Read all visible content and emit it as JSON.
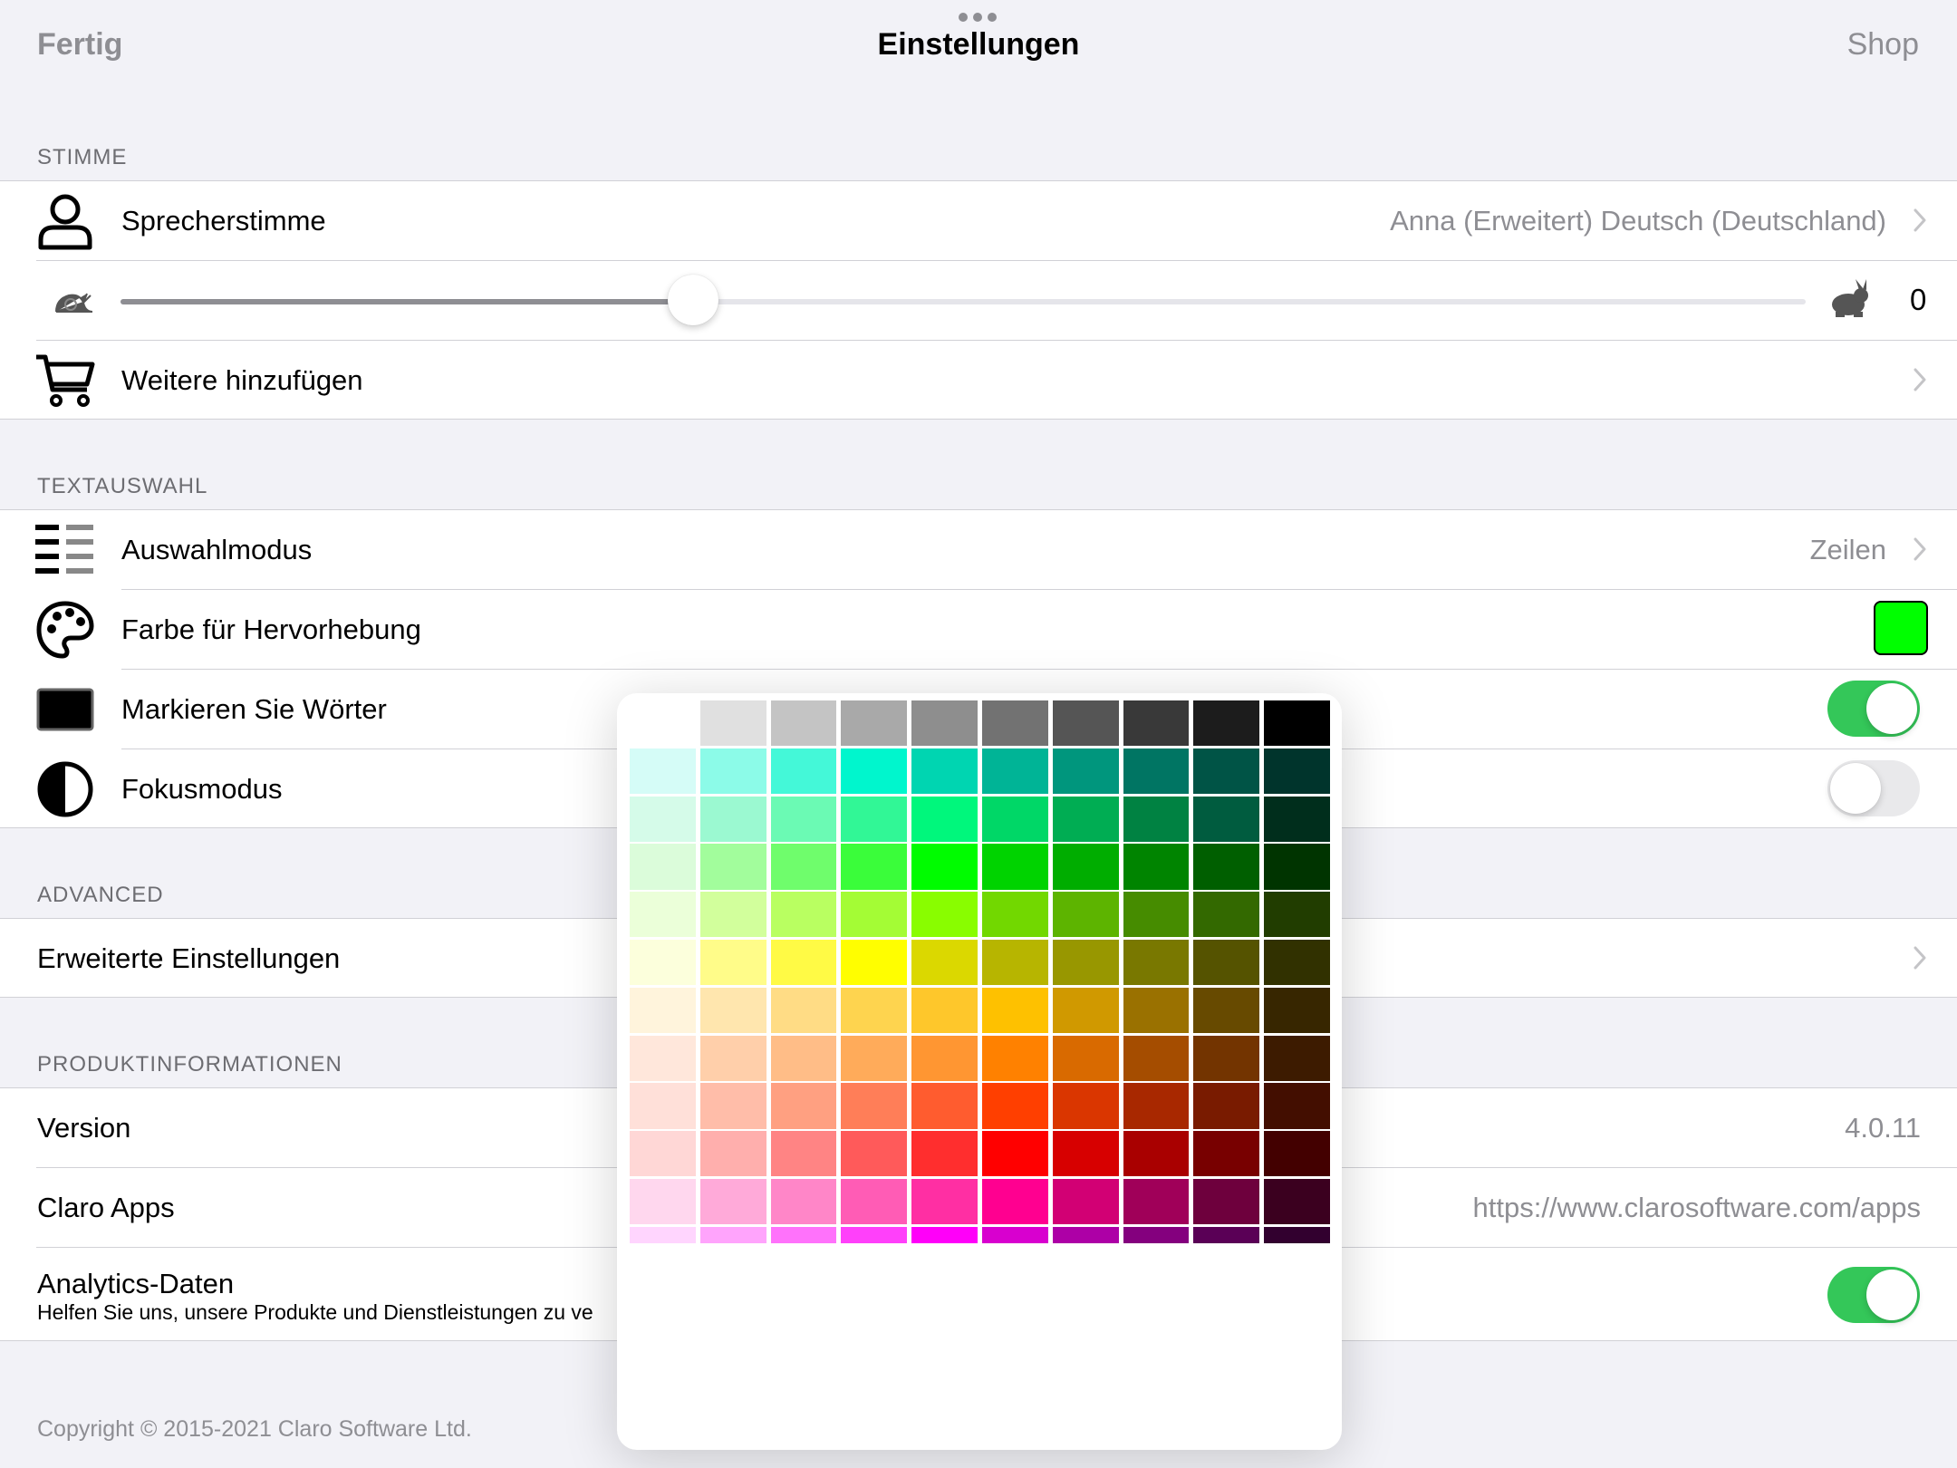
{
  "navbar": {
    "left": "Fertig",
    "title": "Einstellungen",
    "right": "Shop"
  },
  "sections": {
    "stimme": {
      "header": "STIMME",
      "voice_label": "Sprecherstimme",
      "voice_value": "Anna (Erweitert) Deutsch (Deutschland)",
      "speed_value": "0",
      "speed_fraction": 0.34,
      "add_more_label": "Weitere hinzufügen"
    },
    "textauswahl": {
      "header": "TEXTAUSWAHL",
      "mode_label": "Auswahlmodus",
      "mode_value": "Zeilen",
      "highlight_label": "Farbe für Hervorhebung",
      "highlight_color": "#00ff00",
      "mark_words_label": "Markieren Sie Wörter",
      "mark_words_on": true,
      "focus_label": "Fokusmodus",
      "focus_on": false
    },
    "advanced": {
      "header": "ADVANCED",
      "advanced_label": "Erweiterte Einstellungen"
    },
    "produkt": {
      "header": "PRODUKTINFORMATIONEN",
      "version_label": "Version",
      "version_value": "4.0.11",
      "apps_label": "Claro Apps",
      "apps_value": "https://www.clarosoftware.com/apps",
      "analytics_label": "Analytics-Daten",
      "analytics_sub": "Helfen Sie uns, unsere Produkte und Dienstleistungen zu ve",
      "analytics_on": true
    }
  },
  "footer": "Copyright © 2015-2021 Claro Software Ltd.",
  "palette": {
    "rows": [
      [
        "#ffffff",
        "#e0e0e0",
        "#c4c4c4",
        "#a9a9a9",
        "#8e8e8e",
        "#727272",
        "#555555",
        "#393939",
        "#1c1c1c",
        "#000000"
      ],
      [
        "#d5fcf7",
        "#8cfbe8",
        "#44f8d8",
        "#00f6cd",
        "#00d5b1",
        "#00b496",
        "#00967d",
        "#007563",
        "#005446",
        "#00342c"
      ],
      [
        "#d5fbe9",
        "#9bf9d1",
        "#6bfab4",
        "#31f796",
        "#00f77c",
        "#00d767",
        "#00ad53",
        "#008242",
        "#005c3f",
        "#002e1c"
      ],
      [
        "#dbfcda",
        "#a2fd9c",
        "#6ffd6c",
        "#3afd3a",
        "#00fc00",
        "#00d300",
        "#00ad00",
        "#008400",
        "#005f00",
        "#003400"
      ],
      [
        "#ebffd9",
        "#d2ff9c",
        "#b9ff61",
        "#a4fc35",
        "#89fd00",
        "#72d800",
        "#5db400",
        "#468c00",
        "#336900",
        "#213d00"
      ],
      [
        "#fcffdc",
        "#fffc89",
        "#fffa45",
        "#fffe00",
        "#dbd800",
        "#b7b500",
        "#989700",
        "#797800",
        "#555300",
        "#313100"
      ],
      [
        "#fff4dc",
        "#ffe6ae",
        "#ffdc85",
        "#fed44f",
        "#fec72b",
        "#fec100",
        "#d09900",
        "#9a7100",
        "#674a00",
        "#372600"
      ],
      [
        "#ffe7db",
        "#ffcfaa",
        "#ffbd87",
        "#ffab5a",
        "#ff9632",
        "#ff8100",
        "#d96a00",
        "#a54d00",
        "#733400",
        "#3d1b00"
      ],
      [
        "#ffe0d9",
        "#ffbda9",
        "#ffa081",
        "#ff7e58",
        "#ff5c2f",
        "#ff3f00",
        "#da3600",
        "#a82800",
        "#791b00",
        "#430e00"
      ],
      [
        "#ffd7d6",
        "#ffafad",
        "#ff8484",
        "#ff5a5a",
        "#ff2e2e",
        "#ff0000",
        "#d70000",
        "#a90000",
        "#780000",
        "#430000"
      ],
      [
        "#ffd7ee",
        "#ffaad9",
        "#ff86c8",
        "#ff5cb5",
        "#ff2fa3",
        "#ff0090",
        "#d20074",
        "#a00059",
        "#6e003d",
        "#3b001f"
      ],
      [
        "#ffd5fe",
        "#ffa4fc",
        "#ff72fb",
        "#ff40fa",
        "#ff00f9",
        "#d800cf",
        "#ad00a6",
        "#84007e",
        "#5a0056",
        "#32002f"
      ]
    ]
  }
}
